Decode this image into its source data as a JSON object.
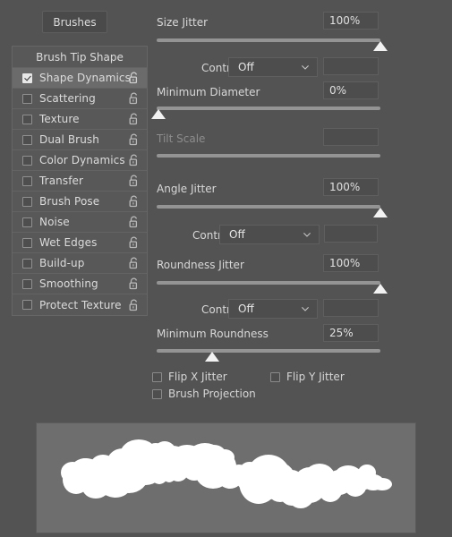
{
  "panel": {
    "tab_label": "Brushes",
    "list_header": "Brush Tip Shape",
    "options": [
      {
        "label": "Shape Dynamics",
        "checked": true,
        "lock": "unlock-icon"
      },
      {
        "label": "Scattering",
        "checked": false,
        "lock": "unlock-icon"
      },
      {
        "label": "Texture",
        "checked": false,
        "lock": "unlock-icon"
      },
      {
        "label": "Dual Brush",
        "checked": false,
        "lock": "unlock-icon"
      },
      {
        "label": "Color Dynamics",
        "checked": false,
        "lock": "unlock-icon"
      },
      {
        "label": "Transfer",
        "checked": false,
        "lock": "unlock-icon"
      },
      {
        "label": "Brush Pose",
        "checked": false,
        "lock": "unlock-icon"
      },
      {
        "label": "Noise",
        "checked": false,
        "lock": "unlock-icon"
      },
      {
        "label": "Wet Edges",
        "checked": false,
        "lock": "unlock-icon"
      },
      {
        "label": "Build-up",
        "checked": false,
        "lock": "unlock-icon"
      },
      {
        "label": "Smoothing",
        "checked": false,
        "lock": "unlock-icon"
      },
      {
        "label": "Protect Texture",
        "checked": false,
        "lock": "unlock-icon"
      }
    ]
  },
  "shape_dynamics": {
    "size_jitter": {
      "label": "Size Jitter",
      "value": "100%",
      "slider_percent": 100
    },
    "size_control": {
      "label": "Control:",
      "value": "Off",
      "extra_value": ""
    },
    "minimum_diameter": {
      "label": "Minimum Diameter",
      "value": "0%",
      "slider_percent": 0
    },
    "tilt_scale": {
      "label": "Tilt Scale",
      "value": "",
      "disabled": true
    },
    "angle_jitter": {
      "label": "Angle Jitter",
      "value": "100%",
      "slider_percent": 100
    },
    "angle_control": {
      "label": "Control:",
      "value": "Off",
      "extra_value": ""
    },
    "roundness_jitter": {
      "label": "Roundness Jitter",
      "value": "100%",
      "slider_percent": 100
    },
    "roundness_control": {
      "label": "Control:",
      "value": "Off",
      "extra_value": ""
    },
    "minimum_roundness": {
      "label": "Minimum Roundness",
      "value": "25%",
      "slider_percent": 25
    },
    "flip_x_jitter": {
      "label": "Flip X Jitter",
      "checked": false
    },
    "flip_y_jitter": {
      "label": "Flip Y Jitter",
      "checked": false
    },
    "brush_projection": {
      "label": "Brush Projection",
      "checked": false
    }
  },
  "colors": {
    "background": "#535353",
    "panel": "#585858",
    "selected_row": "#6b6b6b",
    "field": "#4d4d4d",
    "text": "#d8d8d8",
    "disabled_text": "#8d8d8d",
    "slider_track": "#949494",
    "slider_thumb": "#f2f2f2",
    "preview_bg": "#6e6e6e",
    "stroke": "#ffffff"
  }
}
